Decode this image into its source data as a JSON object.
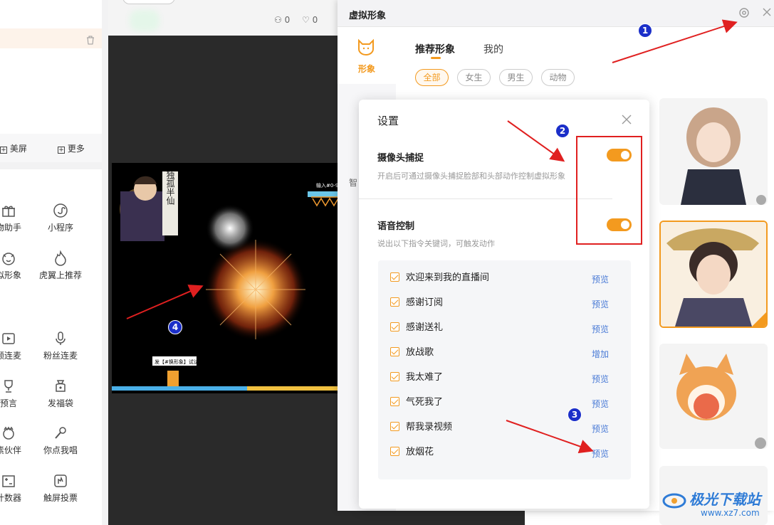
{
  "left_panel": {
    "btn_beauty": "美屏",
    "btn_more": "更多",
    "tools": [
      {
        "label": "物助手",
        "icon": "gift-icon"
      },
      {
        "label": "小程序",
        "icon": "mini-program-icon"
      },
      {
        "label": "拟形象",
        "icon": "avatar-icon"
      },
      {
        "label": "虎翼上推荐",
        "icon": "flame-icon"
      },
      {
        "label": "频连麦",
        "icon": "video-call-icon"
      },
      {
        "label": "粉丝连麦",
        "icon": "microphone-icon"
      },
      {
        "label": "预言",
        "icon": "trophy-icon"
      },
      {
        "label": "发福袋",
        "icon": "lucky-bag-icon"
      },
      {
        "label": "素伙伴",
        "icon": "companion-icon"
      },
      {
        "label": "你点我唱",
        "icon": "karaoke-icon"
      },
      {
        "label": "计数器",
        "icon": "counter-icon"
      },
      {
        "label": "触屏投票",
        "icon": "vote-icon"
      }
    ]
  },
  "stream_header": {
    "likes": "0",
    "hearts": "0"
  },
  "video": {
    "banner_text": "独孤半仙",
    "bottom_caption": "发【#换形象】试试",
    "score_text": "输入#0-9"
  },
  "virtual_panel": {
    "title": "虚拟形象",
    "sidebar_tab": "形象",
    "sidebar_tab2": "智",
    "tabs": [
      "推荐形象",
      "我的"
    ],
    "filters": [
      "全部",
      "女生",
      "男生",
      "动物"
    ]
  },
  "settings_dialog": {
    "title": "设置",
    "camera_label": "摄像头捕捉",
    "camera_desc": "开启后可通过摄像头捕捉脸部和头部动作控制虚拟形象",
    "voice_label": "语音控制",
    "voice_desc": "说出以下指令关键词，可触发动作",
    "commands": [
      {
        "text": "欢迎来到我的直播间",
        "action": "预览"
      },
      {
        "text": "感谢订阅",
        "action": "预览"
      },
      {
        "text": "感谢送礼",
        "action": "预览"
      },
      {
        "text": "放战歌",
        "action": "增加"
      },
      {
        "text": "我太难了",
        "action": "预览"
      },
      {
        "text": "气死我了",
        "action": "预览"
      },
      {
        "text": "帮我录视频",
        "action": "预览"
      },
      {
        "text": "放烟花",
        "action": "预览"
      }
    ]
  },
  "annotations": [
    "1",
    "2",
    "3",
    "4"
  ],
  "watermark": {
    "text": "极光下载站",
    "url": "www.xz7.com"
  },
  "colors": {
    "accent": "#f39a1f",
    "annotation_red": "#e02020",
    "link": "#4a7bd6",
    "marker_blue": "#1b2fc9"
  }
}
